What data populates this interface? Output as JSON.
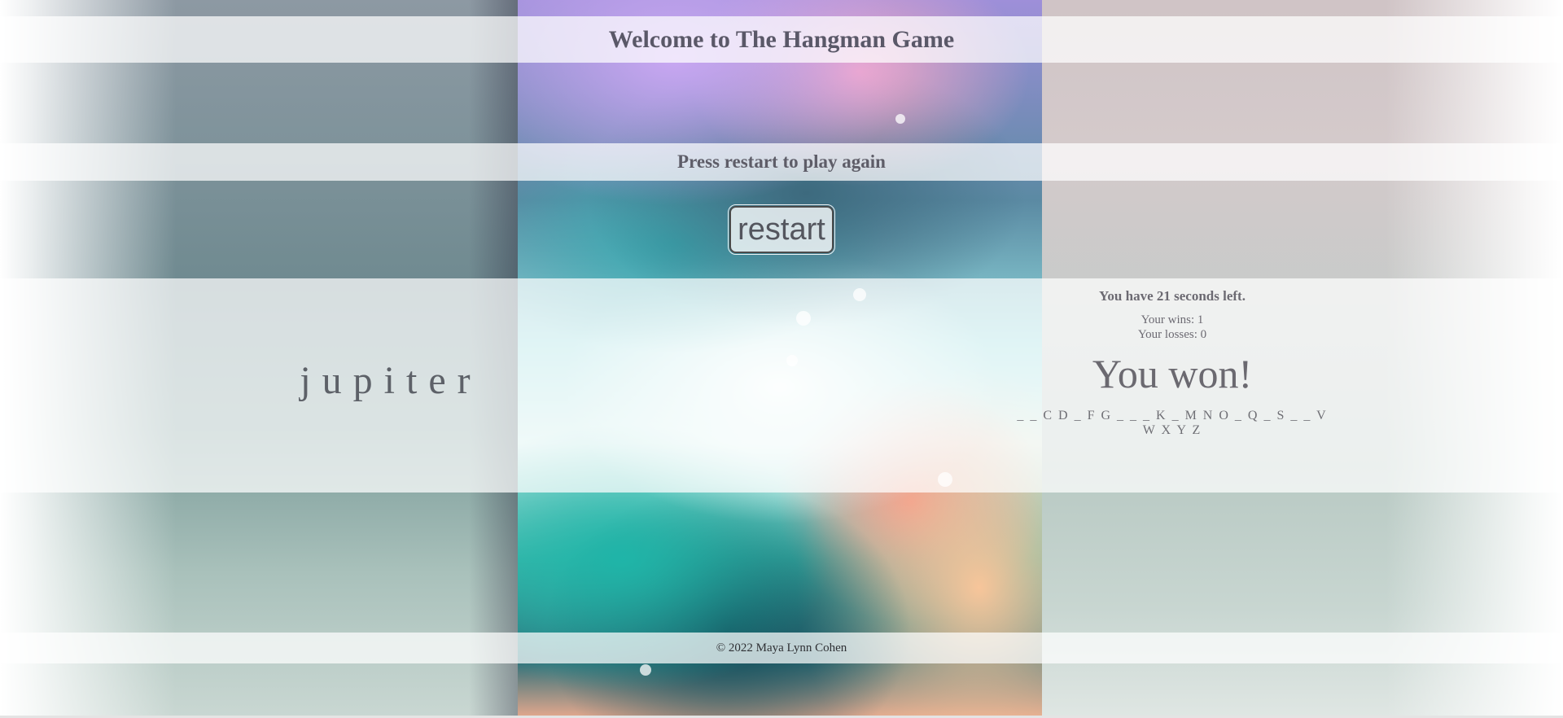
{
  "header": {
    "title": "Welcome to The Hangman Game"
  },
  "game": {
    "restart_message": "Press restart to play again",
    "restart_label": "restart",
    "word": "jupiter",
    "timer_text": "You have 21 seconds left.",
    "wins_text": "Your wins: 1",
    "losses_text": "Your losses: 0",
    "result_text": "You won!",
    "remaining_letters": "_ _ C D _ F G _ _ _ K _ M N O _ Q _ S _ _ V W X Y Z"
  },
  "footer": {
    "copyright": "© 2022 Maya Lynn Cohen"
  },
  "colors": {
    "text_primary": "#5a5868",
    "band_overlay": "rgba(255,255,255,0.72)",
    "footer_text": "#2e3034"
  }
}
